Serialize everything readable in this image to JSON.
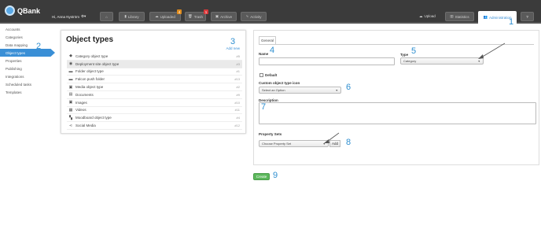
{
  "app": {
    "name": "QBank",
    "user": "Hi, Anna Nyström",
    "gear": "⚙▾"
  },
  "nav": {
    "home_icon": "home-icon",
    "library": "Library",
    "uploaded": "Uploaded",
    "uploaded_badge": "4",
    "trash": "Trash",
    "trash_badge": "1",
    "archive": "Archive",
    "activity": "Activity",
    "upload": "Upload",
    "statistics": "Statistics",
    "administration": "Administration",
    "help": "?"
  },
  "sidebar": {
    "items": [
      {
        "label": "Accounts"
      },
      {
        "label": "Categories"
      },
      {
        "label": "Data mapping"
      },
      {
        "label": "Object types"
      },
      {
        "label": "Properties"
      },
      {
        "label": "Publishing"
      },
      {
        "label": "Integrations"
      },
      {
        "label": "Scheduled tasks"
      },
      {
        "label": "Templates"
      }
    ]
  },
  "annotations": {
    "n1": "1",
    "n2": "2",
    "n3": "3",
    "n4": "4",
    "n5": "5",
    "n6": "6",
    "n7": "7",
    "n8": "8",
    "n9": "9"
  },
  "object_types": {
    "title": "Object types",
    "add_new": "Add new",
    "rows": [
      {
        "name": "Category object type",
        "id": "#5",
        "icon": "tag-icon"
      },
      {
        "name": "Deployment site object type",
        "id": "#3",
        "icon": "globe-icon"
      },
      {
        "name": "Folder object type",
        "id": "#1",
        "icon": "folder-icon"
      },
      {
        "name": "Falcon push folder",
        "id": "#13",
        "icon": "folder-icon"
      },
      {
        "name": "Media object type",
        "id": "#2",
        "icon": "image-icon"
      },
      {
        "name": "Documents",
        "id": "#9",
        "icon": "document-icon"
      },
      {
        "name": "Images",
        "id": "#10",
        "icon": "image-icon"
      },
      {
        "name": "Videos",
        "id": "#11",
        "icon": "video-icon"
      },
      {
        "name": "Moodboard object type",
        "id": "#4",
        "icon": "moodboard-icon"
      },
      {
        "name": "Social Media",
        "id": "#12",
        "icon": "share-icon"
      }
    ]
  },
  "form": {
    "tab": "General",
    "name_label": "Name",
    "name_value": "",
    "type_label": "Type",
    "type_value": "Category",
    "default_label": "Default",
    "icon_label": "Custom object type icon",
    "icon_value": "Select an Option",
    "description_label": "Description",
    "description_value": "",
    "property_sets_label": "Property Sets",
    "property_sets_value": "Choose Property Set",
    "add_label": "Add",
    "create_label": "Create"
  },
  "colors": {
    "accent": "#3a8fd6",
    "create": "#5cb85c",
    "topbar": "#3b3b3b"
  }
}
